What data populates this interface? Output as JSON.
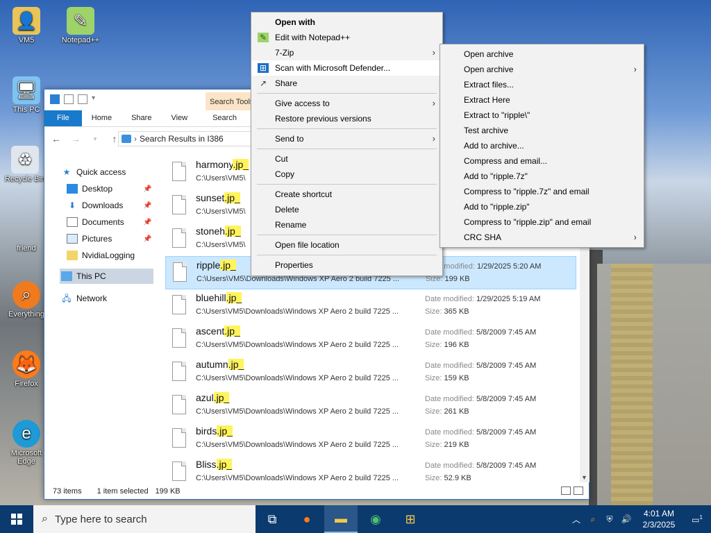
{
  "desktop": {
    "icons": [
      {
        "label": "VM5"
      },
      {
        "label": "Notepad++"
      },
      {
        "label": "This PC"
      },
      {
        "label": "Recycle Bin"
      },
      {
        "label": "friend"
      },
      {
        "label": "Everything"
      },
      {
        "label": "Firefox"
      },
      {
        "label": "Microsoft Edge"
      }
    ]
  },
  "explorer": {
    "contextual_tab": "Search Tools",
    "tabs": [
      "File",
      "Home",
      "Share",
      "View",
      "Search"
    ],
    "address": "Search Results in I386",
    "nav": {
      "quick_access": "Quick access",
      "items": [
        "Desktop",
        "Downloads",
        "Documents",
        "Pictures",
        "NvidiaLogging"
      ],
      "this_pc": "This PC",
      "network": "Network"
    },
    "files": [
      {
        "name": "harmony",
        "ext": ".jp_",
        "path": "C:\\Users\\VM5\\",
        "date_label": "",
        "date": "",
        "size_label": "",
        "size": ""
      },
      {
        "name": "sunset",
        "ext": ".jp_",
        "path": "C:\\Users\\VM5\\",
        "date_label": "",
        "date": "",
        "size_label": "",
        "size": ""
      },
      {
        "name": "stoneh",
        "ext": ".jp_",
        "path": "C:\\Users\\VM5\\",
        "date_label": "",
        "date": "",
        "size_label": "",
        "size": ""
      },
      {
        "name": "ripple",
        "ext": ".jp_",
        "path": "C:\\Users\\VM5\\Downloads\\Windows XP Aero 2 build 7225 ...",
        "date_label": "Date modified:",
        "date": "1/29/2025 5:20 AM",
        "size_label": "Size:",
        "size": "199 KB"
      },
      {
        "name": "bluehill",
        "ext": ".jp_",
        "path": "C:\\Users\\VM5\\Downloads\\Windows XP Aero 2 build 7225 ...",
        "date_label": "Date modified:",
        "date": "1/29/2025 5:19 AM",
        "size_label": "Size:",
        "size": "365 KB"
      },
      {
        "name": "ascent",
        "ext": ".jp_",
        "path": "C:\\Users\\VM5\\Downloads\\Windows XP Aero 2 build 7225 ...",
        "date_label": "Date modified:",
        "date": "5/8/2009 7:45 AM",
        "size_label": "Size:",
        "size": "196 KB"
      },
      {
        "name": "autumn",
        "ext": ".jp_",
        "path": "C:\\Users\\VM5\\Downloads\\Windows XP Aero 2 build 7225 ...",
        "date_label": "Date modified:",
        "date": "5/8/2009 7:45 AM",
        "size_label": "Size:",
        "size": "159 KB"
      },
      {
        "name": "azul",
        "ext": ".jp_",
        "path": "C:\\Users\\VM5\\Downloads\\Windows XP Aero 2 build 7225 ...",
        "date_label": "Date modified:",
        "date": "5/8/2009 7:45 AM",
        "size_label": "Size:",
        "size": "261 KB"
      },
      {
        "name": "birds",
        "ext": ".jp_",
        "path": "C:\\Users\\VM5\\Downloads\\Windows XP Aero 2 build 7225 ...",
        "date_label": "Date modified:",
        "date": "5/8/2009 7:45 AM",
        "size_label": "Size:",
        "size": "219 KB"
      },
      {
        "name": "Bliss",
        "ext": ".jp_",
        "path": "C:\\Users\\VM5\\Downloads\\Windows XP Aero 2 build 7225 ...",
        "date_label": "Date modified:",
        "date": "5/8/2009 7:45 AM",
        "size_label": "Size:",
        "size": "52.9 KB"
      }
    ],
    "status": {
      "items": "73 items",
      "selected": "1 item selected",
      "size": "199 KB"
    }
  },
  "context_menu": {
    "items": [
      {
        "label": "Open with",
        "bold": true,
        "icon": "",
        "submenu": false
      },
      {
        "label": "Edit with Notepad++",
        "icon": "notepadpp-icon",
        "submenu": false
      },
      {
        "label": "7-Zip",
        "icon": "",
        "submenu": true
      },
      {
        "label": "Scan with Microsoft Defender...",
        "icon": "defender-icon",
        "submenu": false
      },
      {
        "label": "Share",
        "icon": "share-icon",
        "submenu": false
      },
      {
        "sep": true
      },
      {
        "label": "Give access to",
        "icon": "",
        "submenu": true
      },
      {
        "label": "Restore previous versions",
        "icon": "",
        "submenu": false
      },
      {
        "sep": true
      },
      {
        "label": "Send to",
        "icon": "",
        "submenu": true
      },
      {
        "sep": true
      },
      {
        "label": "Cut",
        "icon": "",
        "submenu": false
      },
      {
        "label": "Copy",
        "icon": "",
        "submenu": false
      },
      {
        "sep": true
      },
      {
        "label": "Create shortcut",
        "icon": "",
        "submenu": false
      },
      {
        "label": "Delete",
        "icon": "",
        "submenu": false
      },
      {
        "label": "Rename",
        "icon": "",
        "submenu": false
      },
      {
        "sep": true
      },
      {
        "label": "Open file location",
        "icon": "",
        "submenu": false
      },
      {
        "sep": true
      },
      {
        "label": "Properties",
        "icon": "",
        "submenu": false
      }
    ]
  },
  "zip_menu": {
    "items": [
      {
        "label": "Open archive",
        "submenu": false
      },
      {
        "label": "Open archive",
        "submenu": true
      },
      {
        "label": "Extract files...",
        "submenu": false
      },
      {
        "label": "Extract Here",
        "submenu": false
      },
      {
        "label": "Extract to \"ripple\\\"",
        "submenu": false
      },
      {
        "label": "Test archive",
        "submenu": false
      },
      {
        "label": "Add to archive...",
        "submenu": false
      },
      {
        "label": "Compress and email...",
        "submenu": false
      },
      {
        "label": "Add to \"ripple.7z\"",
        "submenu": false
      },
      {
        "label": "Compress to \"ripple.7z\" and email",
        "submenu": false
      },
      {
        "label": "Add to \"ripple.zip\"",
        "submenu": false
      },
      {
        "label": "Compress to \"ripple.zip\" and email",
        "submenu": false
      },
      {
        "label": "CRC SHA",
        "submenu": true
      }
    ]
  },
  "taskbar": {
    "search_placeholder": "Type here to search",
    "time": "4:01 AM",
    "date": "2/3/2025",
    "notification_count": "1"
  },
  "colors": {
    "accent": "#1979ca",
    "selection": "#cce8ff",
    "highlight": "#fff45c",
    "taskbar": "#0b3a6e"
  }
}
